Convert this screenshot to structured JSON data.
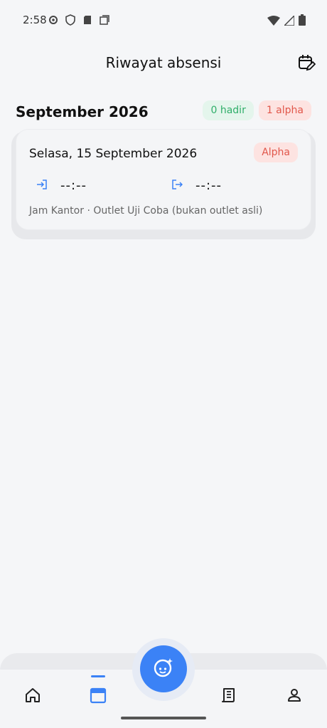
{
  "status_bar": {
    "time": "2:58"
  },
  "header": {
    "title": "Riwayat absensi"
  },
  "month": {
    "title": "September 2026",
    "badge_hadir": "0 hadir",
    "badge_alpha": "1 alpha"
  },
  "records": [
    {
      "date": "Selasa, 15 September 2026",
      "status": "Alpha",
      "check_in": "--:--",
      "check_out": "--:--",
      "footer": "Jam Kantor · Outlet Uji Coba (bukan outlet asli)"
    }
  ],
  "colors": {
    "accent": "#3b82f6",
    "hadir_bg": "#e4f5ec",
    "hadir_text": "#2fae69",
    "alpha_bg": "#fde3e1",
    "alpha_text": "#e1574b"
  },
  "icons": {
    "header_action": "calendar-edit-icon",
    "nav": [
      "home-icon",
      "calendar-icon",
      "face-scan-icon",
      "report-icon",
      "profile-icon"
    ],
    "check_in": "login-icon",
    "check_out": "logout-icon"
  }
}
